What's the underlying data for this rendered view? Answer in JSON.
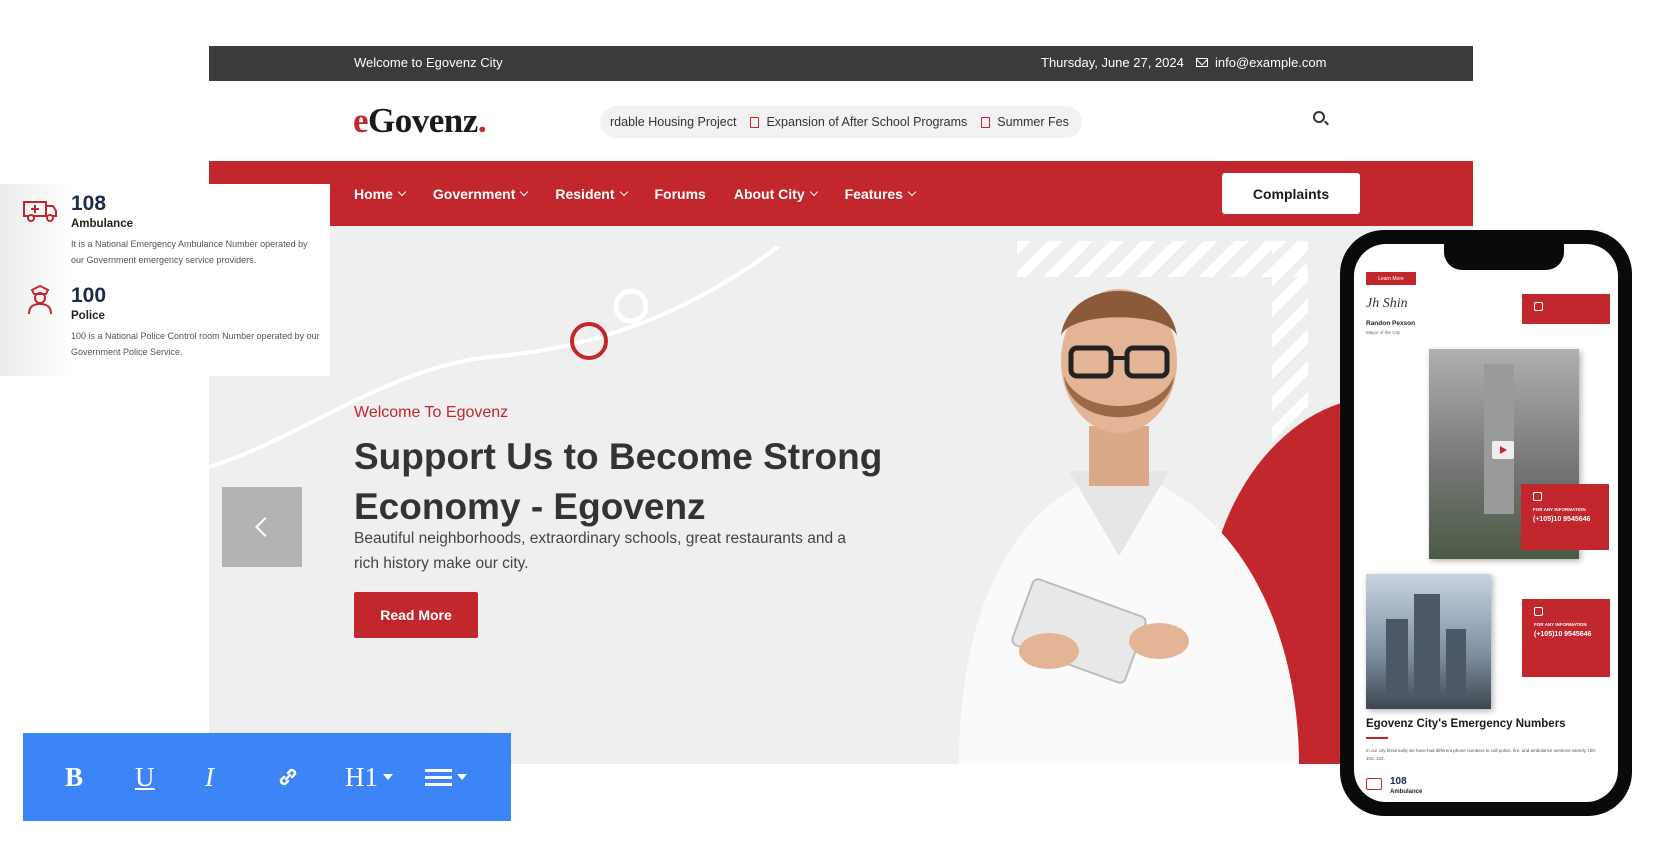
{
  "site": {
    "topbar": {
      "welcome": "Welcome to Egovenz City",
      "date": "Thursday, June 27, 2024",
      "email": "info@example.com"
    },
    "logo": {
      "prefix": "e",
      "main": "Govenz",
      "suffix": "."
    },
    "ticker": {
      "items": [
        "rdable Housing Project",
        "Expansion of After School Programs",
        "Summer Fes"
      ]
    },
    "nav": {
      "items": [
        {
          "label": "Home",
          "has_dropdown": true
        },
        {
          "label": "Government",
          "has_dropdown": true
        },
        {
          "label": "Resident",
          "has_dropdown": true
        },
        {
          "label": "Forums",
          "has_dropdown": false
        },
        {
          "label": "About City",
          "has_dropdown": true
        },
        {
          "label": "Features",
          "has_dropdown": true
        }
      ],
      "cta": "Complaints"
    },
    "hero": {
      "subtitle": "Welcome To Egovenz",
      "title": "Support Us to Become Strong Economy - Egovenz",
      "text": "Beautiful neighborhoods, extraordinary schools, great restaurants and a rich history make our city.",
      "button": "Read More"
    }
  },
  "services_card": {
    "items": [
      {
        "number": "108",
        "name": "Ambulance",
        "desc": "It is a National Emergency Ambulance Number operated by our Government emergency service providers.",
        "icon": "ambulance-icon"
      },
      {
        "number": "100",
        "name": "Police",
        "desc": "100 is a National Police Control room Number operated by our Government Police Service.",
        "icon": "police-icon"
      }
    ]
  },
  "editor_toolbar": {
    "bold": "B",
    "underline": "U",
    "italic": "I",
    "heading": "H1",
    "icons": [
      "bold-icon",
      "underline-icon",
      "italic-icon",
      "link-icon",
      "heading-icon",
      "list-icon"
    ]
  },
  "mobile": {
    "learn_more": "Learn More",
    "signature": "Jh Shin",
    "mayor_name": "Randon Pexson",
    "mayor_role": "Mayor of the City",
    "info_label": "FOR ANY INFORMATION",
    "info_number": "(+105)10 9545646",
    "emergency_heading": "Egovenz City's Emergency Numbers",
    "emergency_text": "In our city historically we have had different phone numbers to call police, fire, and ambulance services namely 100, 102, 103.",
    "first_number": "108",
    "first_name": "Ambulance"
  },
  "colors": {
    "brand_red": "#c1272d",
    "topbar": "#3b3b3b",
    "toolbar_blue": "#3d84f7",
    "navy": "#1b2a4a"
  }
}
